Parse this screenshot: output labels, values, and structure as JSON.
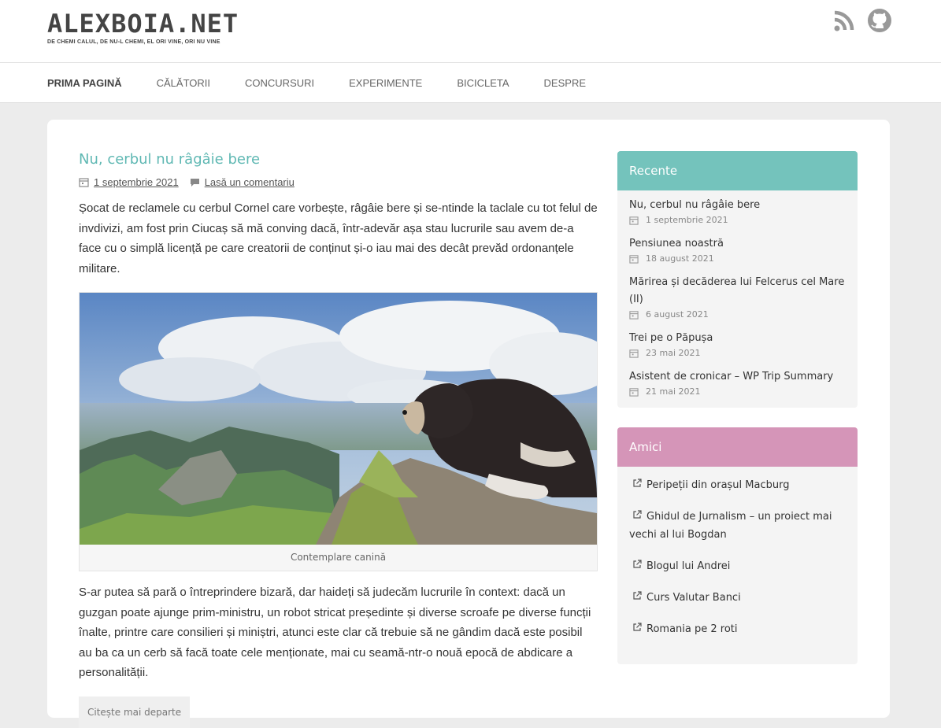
{
  "site": {
    "title": "ALEXBOIA.NET",
    "tagline": "DE CHEMI CALUL, DE NU-L CHEMI, EL ORI VINE, ORI NU VINE"
  },
  "social": [
    {
      "icon": "rss-icon"
    },
    {
      "icon": "github-icon"
    }
  ],
  "nav": {
    "items": [
      {
        "label": "PRIMA PAGINĂ",
        "active": true
      },
      {
        "label": "CĂLĂTORII"
      },
      {
        "label": "CONCURSURI"
      },
      {
        "label": "EXPERIMENTE"
      },
      {
        "label": "BICICLETA"
      },
      {
        "label": "DESPRE"
      }
    ]
  },
  "post": {
    "title": "Nu, cerbul nu râgâie bere",
    "date": "1 septembrie 2021",
    "comments": "Lasă un comentariu",
    "intro": "Șocat de reclamele cu cerbul Cornel care vorbește, râgâie bere și se-ntinde la taclale cu tot felul de invdivizi, am fost prin Ciucaș să mă conving dacă, într-adevăr așa stau lucrurile sau avem de-a face cu o simplă licență pe care creatorii de conținut și-o iau mai des decât prevăd ordonanțele militare.",
    "caption": "Contemplare canină",
    "body": "S-ar putea să pară o întreprindere bizară, dar haideți să judecăm lucrurile în context: dacă un guzgan poate ajunge prim-ministru, un robot stricat președinte și diverse scroafe pe diverse funcții înalte, printre care consilieri și miniștri, atunci este clar că trebuie să ne gândim dacă este posibil au ba ca un cerb să facă toate cele menționate, mai cu seamă-ntr-o nouă epocă de abdicare a personalității.",
    "read_more": "Citește mai departe"
  },
  "sidebar": {
    "recent": {
      "title": "Recente",
      "color": "#74c3bc",
      "items": [
        {
          "title": "Nu, cerbul nu râgâie bere",
          "date": "1 septembrie 2021"
        },
        {
          "title": "Pensiunea noastră",
          "date": "18 august 2021"
        },
        {
          "title": "Mărirea și decăderea lui Felcerus cel Mare (II)",
          "date": "6 august 2021"
        },
        {
          "title": "Trei pe o Păpușa",
          "date": "23 mai 2021"
        },
        {
          "title": "Asistent de cronicar – WP Trip Summary",
          "date": "21 mai 2021"
        }
      ]
    },
    "friends": {
      "title": "Amici",
      "color": "#d595b8",
      "items": [
        {
          "label": "Peripeții din orașul Macburg"
        },
        {
          "label": "Ghidul de Jurnalism – un proiect mai vechi al lui Bogdan"
        },
        {
          "label": "Blogul lui Andrei"
        },
        {
          "label": "Curs Valutar Banci"
        },
        {
          "label": "Romania pe 2 roti"
        }
      ]
    }
  }
}
